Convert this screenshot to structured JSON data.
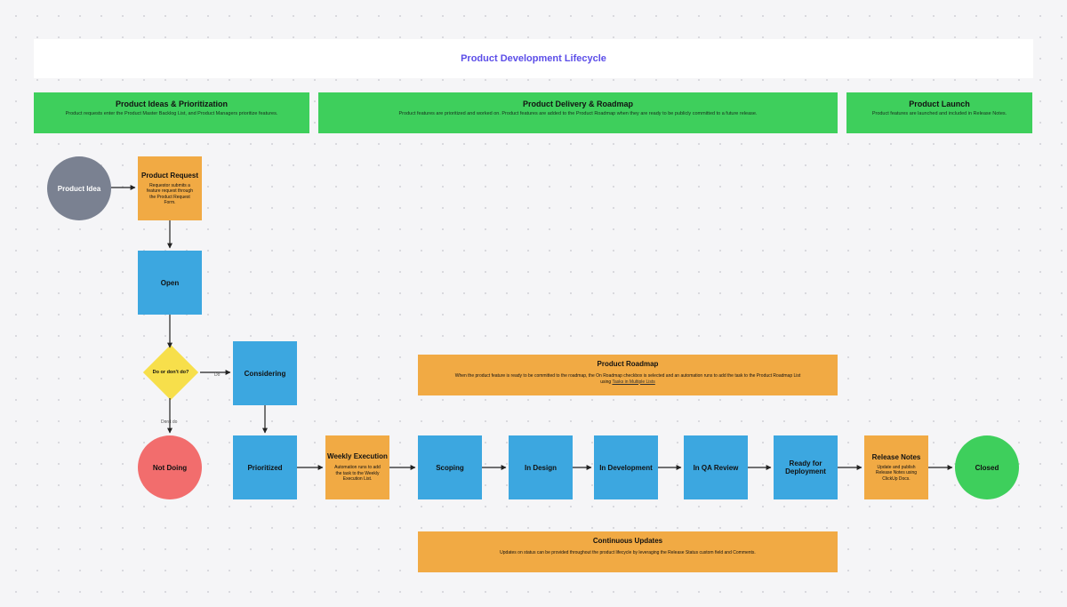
{
  "title": "Product Development Lifecycle",
  "phases": {
    "p1": {
      "title": "Product Ideas & Prioritization",
      "sub": "Product requests enter the Product Master Backlog List, and Product Managers prioritize features."
    },
    "p2": {
      "title": "Product Delivery & Roadmap",
      "sub": "Product features are prioritized and worked on. Product features are added to the Product Roadmap when they are ready to be publicly committed to a future release."
    },
    "p3": {
      "title": "Product Launch",
      "sub": "Product features are launched and included in Release Notes."
    }
  },
  "nodes": {
    "idea": "Product Idea",
    "request": {
      "title": "Product Request",
      "sub": "Requestor submits a feature request through the Product Request Form."
    },
    "open": "Open",
    "decision": "Do or don't do?",
    "considering": "Considering",
    "notdoing": "Not Doing",
    "prioritized": "Prioritized",
    "weekly": {
      "title": "Weekly Execution",
      "sub": "Automation runs to add the task to the Weekly Execution List."
    },
    "scoping": "Scoping",
    "indesign": "In Design",
    "indev": "In Development",
    "inqa": "In QA Review",
    "ready": "Ready for Deployment",
    "relnotes": {
      "title": "Release Notes",
      "sub": "Update and publish Release Notes using ClickUp Docs."
    },
    "closed": "Closed"
  },
  "wide": {
    "roadmap": {
      "title": "Product Roadmap",
      "sub_text": "When the product feature is ready to be committed to the roadmap, the On Roadmap checkbox is selected and an automation runs to add the task to the Product Roadmap List using ",
      "sub_link": "Tasks in Multiple Lists"
    },
    "updates": {
      "title": "Continuous Updates",
      "sub": "Updates on status can be provided throughout the product lifecycle by leveraging the Release Status custom field and Comments."
    }
  },
  "edges": {
    "do": "Do",
    "dontdo": "Don't do"
  }
}
